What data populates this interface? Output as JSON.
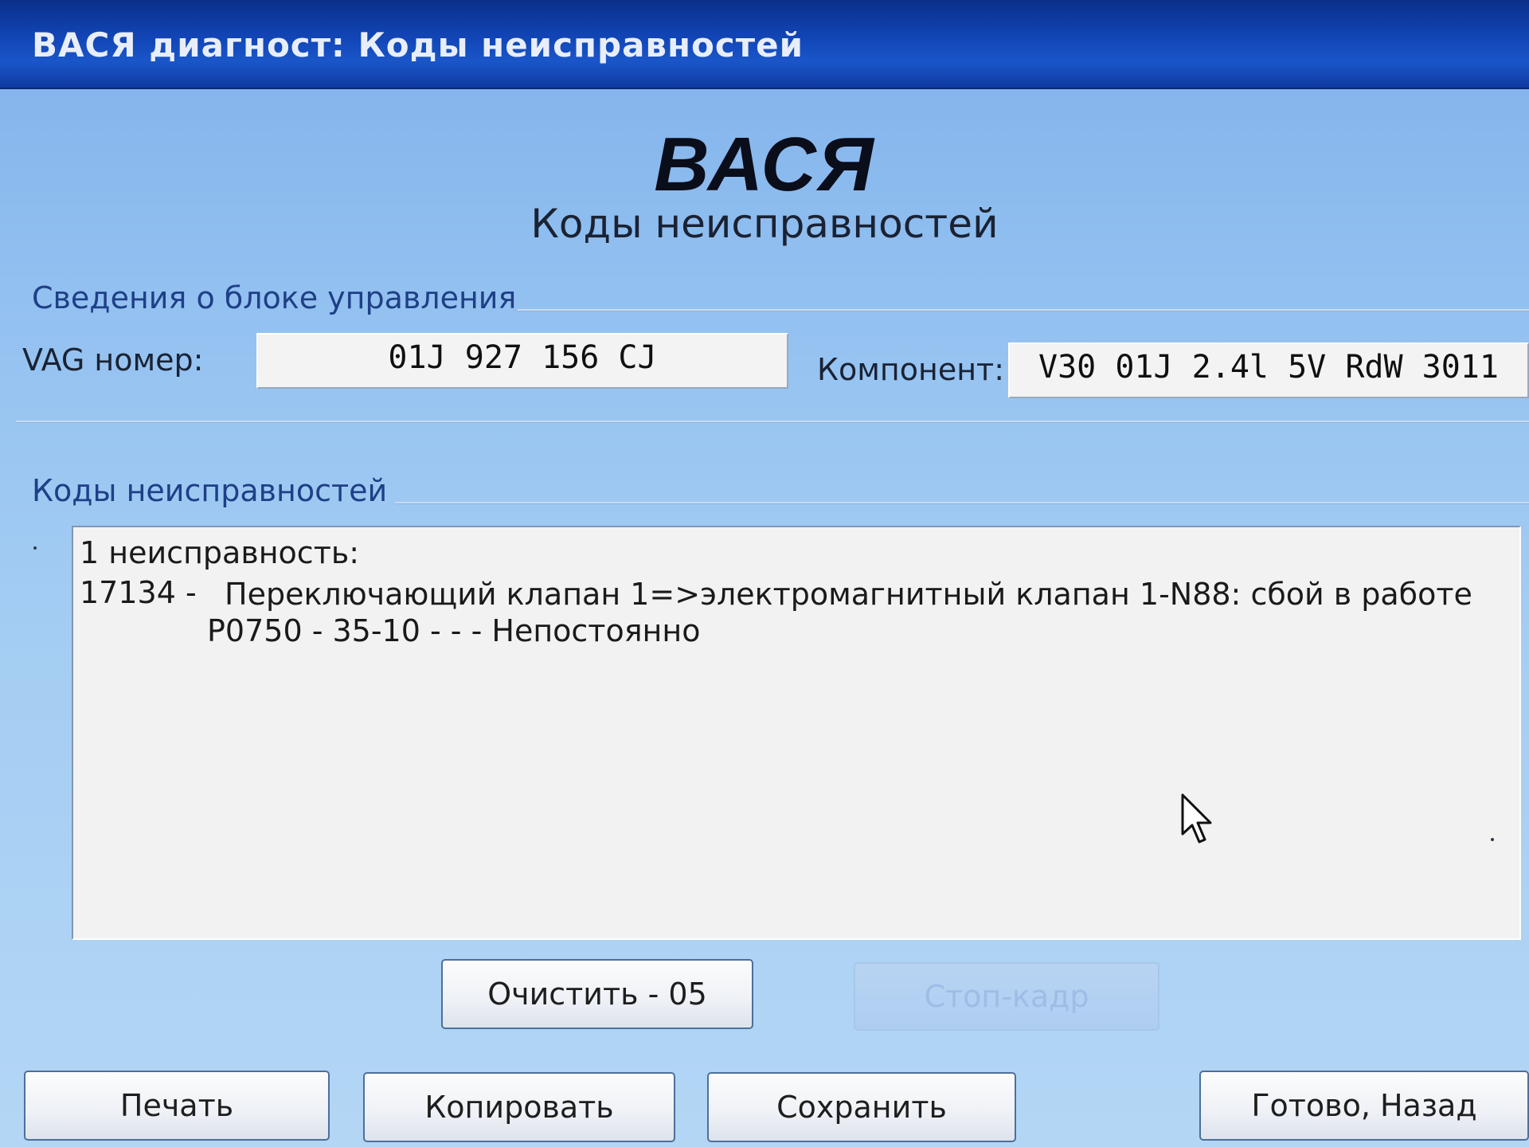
{
  "window": {
    "title": "ВАСЯ диагност: Коды неисправностей"
  },
  "header": {
    "logo": "ВАСЯ",
    "subtitle": "Коды неисправностей"
  },
  "control_unit": {
    "group_label": "Сведения о блоке управления",
    "vag_label": "VAG номер:",
    "vag_value": "01J 927 156 CJ",
    "component_label": "Компонент:",
    "component_value": "V30 01J 2.4l 5V RdW 3011"
  },
  "fault_codes": {
    "group_label": "Коды неисправностей",
    "summary": "1 неисправность:",
    "entries": [
      {
        "code": "17134 -",
        "description": "Переключающий клапан 1=>электромагнитный клапан 1-N88: сбой в работе",
        "detail": "P0750 - 35-10 -    - - Непостоянно"
      }
    ]
  },
  "buttons": {
    "clear": "Очистить - 05",
    "freeze_frame": "Стоп-кадр",
    "print": "Печать",
    "copy": "Копировать",
    "save": "Сохранить",
    "done_back": "Готово, Назад"
  }
}
